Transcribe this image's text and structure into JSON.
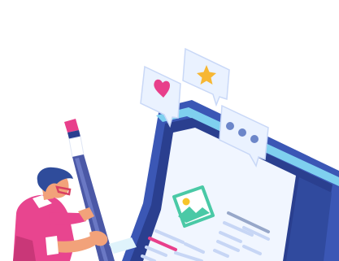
{
  "illustration": {
    "colors": {
      "laptop_outer": "#3b57b5",
      "laptop_inner": "#2a3f8f",
      "laptop_edge": "#7fd0ef",
      "screen": "#f1f6ff",
      "image_card_stroke": "#4ac9a6",
      "image_card_fill": "#ffffff",
      "sun": "#f7c52b",
      "mountain": "#4ac9a6",
      "text_lines": "#c7d6f5",
      "accent_pink": "#e83f8b",
      "bubble": "#eaf2ff",
      "bubble_stroke": "#c9d8f7",
      "heart": "#e83f8b",
      "star": "#f7b733",
      "dots": "#6c86c9",
      "pencil_body": "#4b58a6",
      "pencil_tip": "#e83f8b",
      "pencil_ferrule": "#ffffff",
      "shirt": "#e8458f",
      "hair": "#2f4c9b",
      "skin": "#f2a27a",
      "glasses": "#d93f63"
    },
    "icons": {
      "heart_bubble": "heart-icon",
      "star_bubble": "star-icon",
      "dots_bubble": "typing-dots-icon",
      "image_card": "image-icon"
    }
  }
}
